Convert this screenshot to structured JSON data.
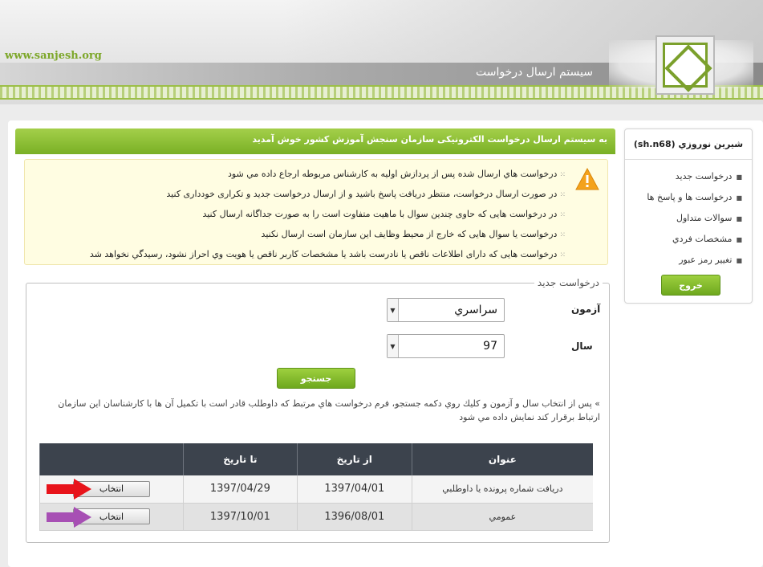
{
  "header": {
    "site_url": "www.sanjesh.org",
    "system_title": "سیستم ارسال درخواست"
  },
  "sidebar": {
    "user": "شيرين نوروزي (sh.n68)",
    "items": [
      {
        "label": "درخواست جدید"
      },
      {
        "label": "درخواست ها و پاسخ ها"
      },
      {
        "label": "سوالات متداول"
      },
      {
        "label": "مشخصات فردي"
      },
      {
        "label": "تغيير رمز عبور"
      }
    ],
    "logout_label": "خروج"
  },
  "main": {
    "welcome": "به سیستم ارسال درخواست الکترونیکی سازمان سنجش آموزش کشور خوش آمدید",
    "notices": [
      "درخواست هاي ارسال شده پس از پردازش اولیه به کارشناس مربوطه ارجاع داده مي شود",
      "در صورت ارسال درخواست، منتظر دریافت پاسخ باشید و از ارسال درخواست جدید و تکراری خودداری کنید",
      "در درخواست هایی که حاوی چندین سوال با ماهیت متفاوت است را به صورت جداگانه ارسال کنید",
      "درخواست یا سوال هایی که خارج از محیط وظایف این سازمان است ارسال نکنید",
      "درخواست هایی که دارای اطلاعات ناقص یا نادرست باشد یا مشخصات کاربر ناقص یا هویت وي احراز نشود، رسیدگي نخواهد شد"
    ],
    "new_request": {
      "legend": "درخواست جدید",
      "exam_label": "آزمون",
      "exam_value": "سراسري",
      "year_label": "سال",
      "year_value": "97",
      "search_label": "جستجو",
      "hint": "» پس از انتخاب سال و آزمون و کلیك روي دکمه جستجو، فرم درخواست هاي مرتبط که داوطلب قادر است با تکمیل آن ها با کارشناسان این سازمان ارتباط برقرار کند نمایش داده مي شود"
    },
    "table": {
      "headers": [
        "عنوان",
        "از تاريخ",
        "تا تاريخ",
        ""
      ],
      "rows": [
        {
          "title": "دريافت شماره پرونده يا داوطلبي",
          "from": "1397/04/01",
          "to": "1397/04/29",
          "action": "انتخاب"
        },
        {
          "title": "عمومي",
          "from": "1396/08/01",
          "to": "1397/10/01",
          "action": "انتخاب"
        }
      ]
    }
  },
  "colors": {
    "accent_green": "#79b025",
    "arrow_red": "#e8141b",
    "arrow_purple": "#a74fb4",
    "table_header": "#3c434d"
  }
}
